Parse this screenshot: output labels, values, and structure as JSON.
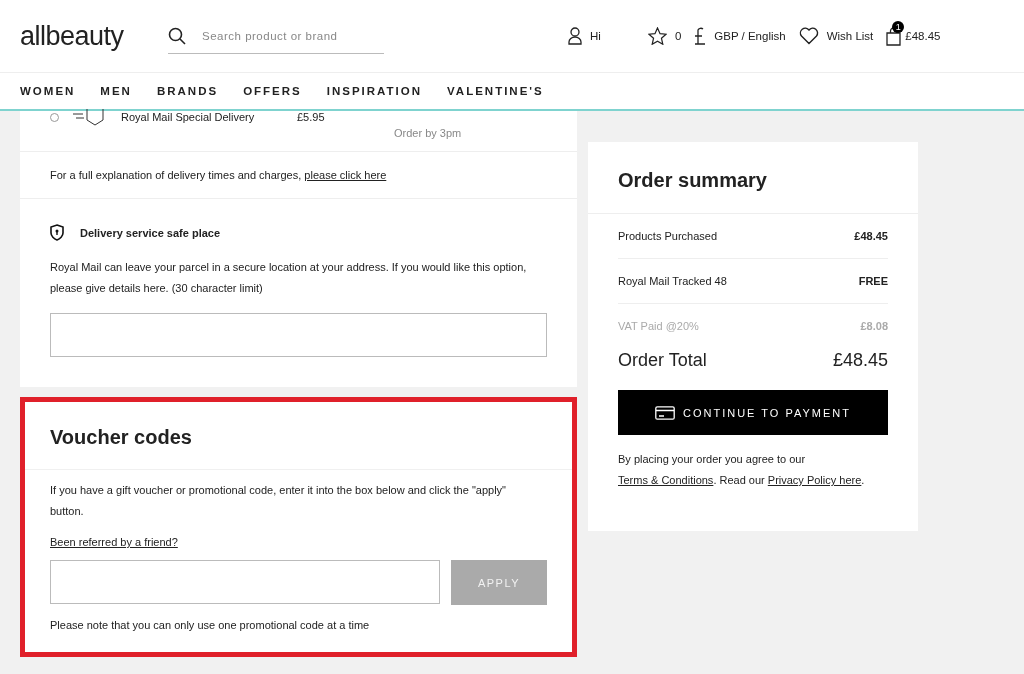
{
  "header": {
    "logo": "allbeauty",
    "search": {
      "placeholder": "Search product or brand"
    },
    "account": "Hi",
    "favourites": "0",
    "currency": "GBP / English",
    "wishlist": "Wish List",
    "basket": {
      "count": "1",
      "total": "£48.45"
    }
  },
  "nav": [
    "WOMEN",
    "MEN",
    "BRANDS",
    "OFFERS",
    "INSPIRATION",
    "VALENTINE'S"
  ],
  "delivery_option": {
    "selected": false,
    "name": "Royal Mail Special Delivery",
    "price": "£5.95",
    "note": "Order by 3pm"
  },
  "explanation": {
    "text": "For a full explanation of delivery times and charges,",
    "link": "please click here"
  },
  "safe_place": {
    "title": "Delivery service safe place",
    "text": "Royal Mail can leave your parcel in a secure location at your address. If you would like this option, please give details here. (30 character limit)"
  },
  "voucher": {
    "highlighted": true,
    "title": "Voucher codes",
    "text": "If you have a gift voucher or promotional code, enter it into the box below and click the \"apply\" button.",
    "referral": "Been referred by a friend?",
    "apply": {
      "label": "APPLY",
      "disabled": true
    },
    "note": "Please note that you can only use one promotional code at a time"
  },
  "summary": {
    "title": "Order summary",
    "rows": [
      {
        "label": "Products Purchased",
        "value": "£48.45",
        "muted": false
      },
      {
        "label": "Royal Mail Tracked 48",
        "value": "FREE",
        "muted": false
      },
      {
        "label": "VAT Paid @20%",
        "value": "£8.08",
        "muted": true
      }
    ],
    "total_label": "Order Total",
    "total": "£48.45",
    "button": "CONTINUE TO PAYMENT",
    "terms": {
      "before": "By placing your order you agree to our",
      "terms_link": "Terms & Conditions",
      "middle": ". Read our",
      "privacy_link": "Privacy Policy here",
      "after": "."
    }
  }
}
